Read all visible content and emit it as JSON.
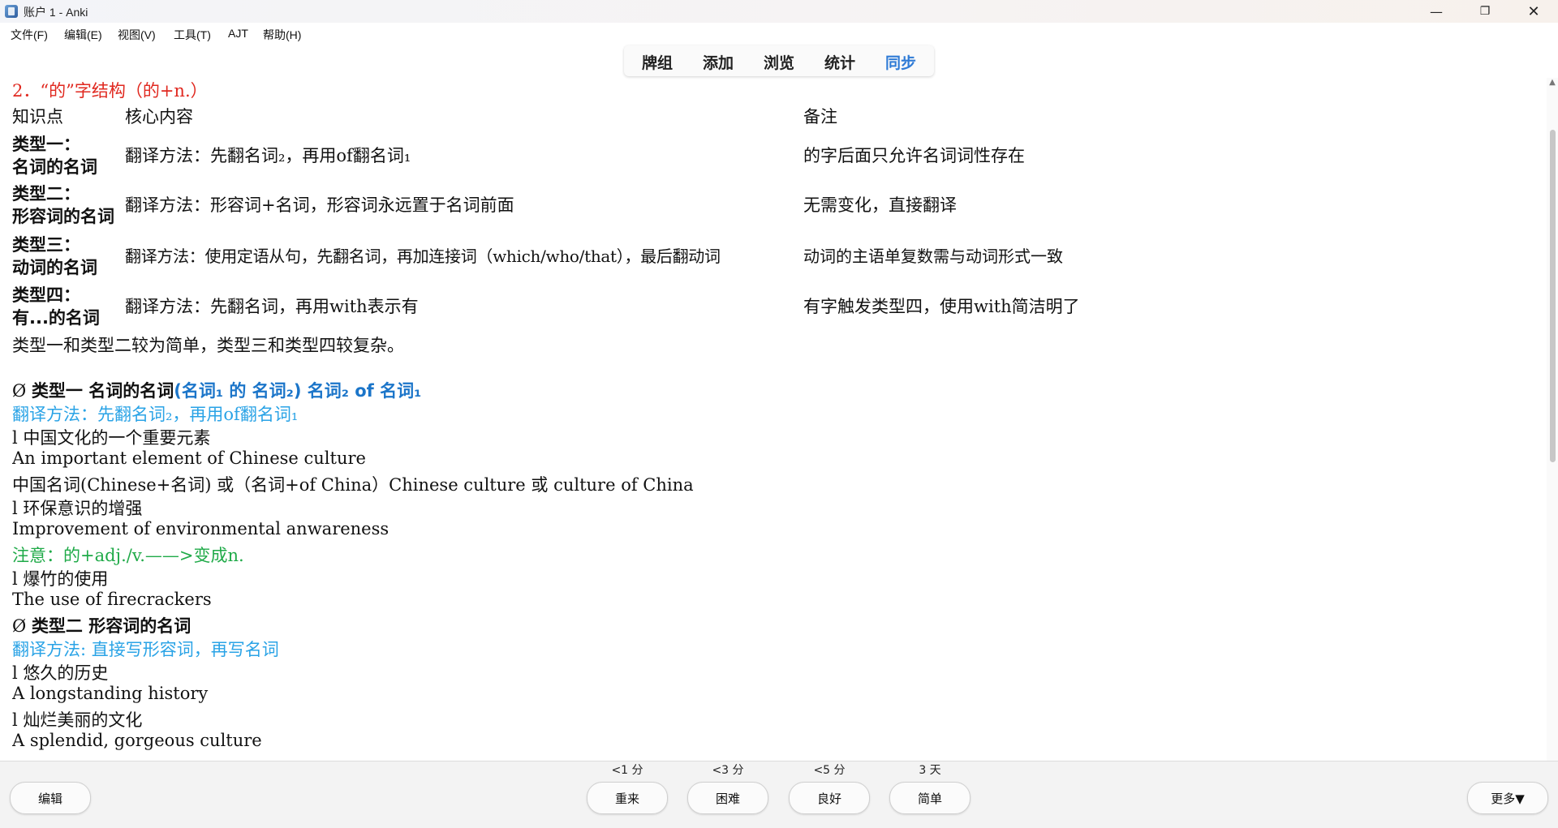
{
  "window": {
    "title": "账户 1 - Anki",
    "minimize": "—",
    "maximize": "❐",
    "close": "✕"
  },
  "menu": [
    "文件(F)",
    "编辑(E)",
    "视图(V)",
    "工具(T)",
    "AJT",
    "帮助(H)"
  ],
  "toolbar": [
    "牌组",
    "添加",
    "浏览",
    "统计",
    "同步"
  ],
  "card": {
    "heading": "2．“的”字结构（的+n.）",
    "table": {
      "headers": [
        "知识点",
        "核心内容",
        "备注"
      ],
      "rows": [
        {
          "type": [
            "类型一：",
            "名词的名词"
          ],
          "content": "翻译方法：先翻名词₂，再用of翻名词₁",
          "note": "的字后面只允许名词词性存在"
        },
        {
          "type": [
            "类型二：",
            "形容词的名词"
          ],
          "content": "翻译方法：形容词+名词，形容词永远置于名词前面",
          "note": "无需变化，直接翻译"
        },
        {
          "type": [
            "类型三：",
            "动词的名词"
          ],
          "content": "翻译方法：使用定语从句，先翻名词，再加连接词（which/who/that），最后翻动词",
          "note": "动词的主语单复数需与动词形式一致"
        },
        {
          "type": [
            "类型四：",
            "有...的名词"
          ],
          "content": "翻译方法：先翻名词，再用with表示有",
          "note": "有字触发类型四，使用with简洁明了"
        }
      ]
    },
    "summary": "类型一和类型二较为简单，类型三和类型四较复杂。",
    "section1": {
      "symbol": "Ø",
      "title_black": "类型一 名词的名词",
      "title_blue": "(名词₁ 的 名词₂) 名词₂ of 名词₁",
      "method": "翻译方法：先翻名词₂，再用of翻名词₁",
      "ex1_cn": "l  中国文化的一个重要元素",
      "ex1_en": "An important element of Chinese culture",
      "ex1_note": "中国名词(Chinese+名词) 或（名词+of China）Chinese culture 或 culture of China",
      "ex2_cn": "l  环保意识的增强",
      "ex2_en": "Improvement of environmental anwareness",
      "attention": "注意：的+adj./v.——>变成n.",
      "ex3_cn": "l  爆竹的使用",
      "ex3_en": "The use of firecrackers"
    },
    "section2": {
      "symbol": "Ø",
      "title_black": "类型二 形容词的名词",
      "method": "翻译方法: 直接写形容词，再写名词",
      "ex1_cn": "l  悠久的历史",
      "ex1_en": "A longstanding history",
      "ex2_cn": "l  灿烂美丽的文化",
      "ex2_en": "A splendid, gorgeous culture"
    }
  },
  "bottom": {
    "edit": "编辑",
    "more": "更多▼",
    "answers": [
      {
        "label": "重来",
        "interval": "<1 分"
      },
      {
        "label": "困难",
        "interval": "<3 分"
      },
      {
        "label": "良好",
        "interval": "<5 分"
      },
      {
        "label": "简单",
        "interval": "3 天"
      }
    ]
  }
}
